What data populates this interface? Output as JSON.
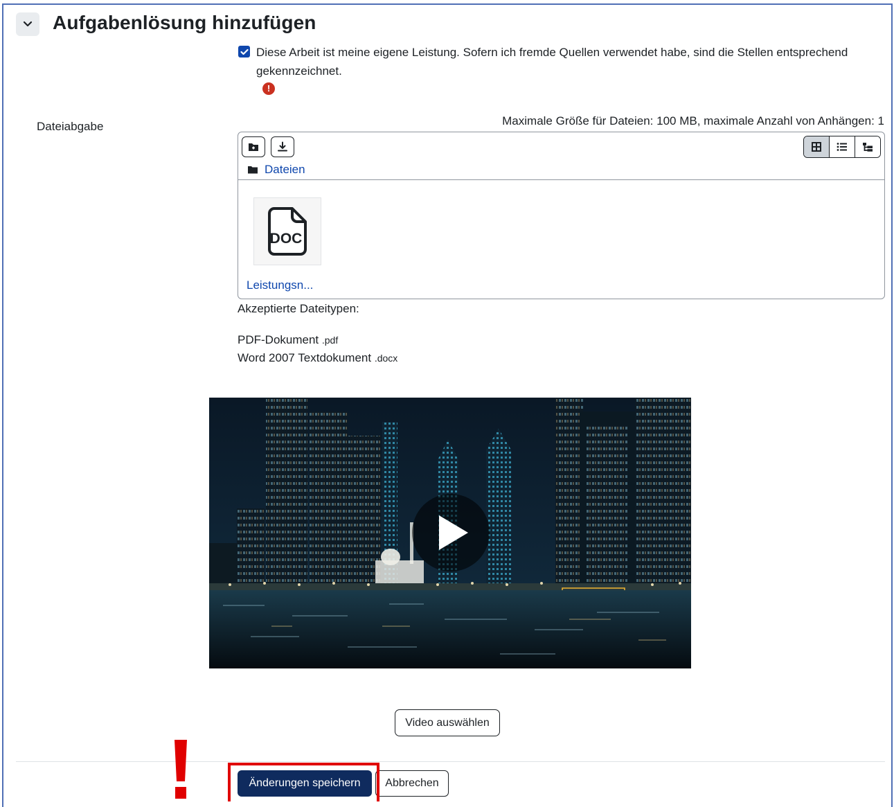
{
  "section": {
    "title": "Aufgabenlösung hinzufügen",
    "collapse_icon": "chevron-down-icon"
  },
  "own_work": {
    "checked": true,
    "label": "Diese Arbeit ist meine eigene Leistung. Sofern ich fremde Quellen verwendet habe, sind die Stellen entsprechend gekennzeichnet.",
    "error_icon": "!"
  },
  "file_submission": {
    "label": "Dateiabgabe",
    "limits": "Maximale Größe für Dateien: 100 MB, maximale Anzahl von Anhängen: 1",
    "toolbar": {
      "add_icon": "add-folder-icon",
      "download_icon": "download-icon",
      "view_modes": [
        "grid-view-icon",
        "list-view-icon",
        "tree-view-icon"
      ],
      "active_view": "grid-view-icon"
    },
    "path": "Dateien",
    "file": {
      "icon_text": "DOC",
      "name": "Leistungsn..."
    },
    "accepted_title": "Akzeptierte Dateitypen:",
    "accepted_types": [
      {
        "name": "PDF-Dokument",
        "ext": ".pdf"
      },
      {
        "name": "Word 2007 Textdokument",
        "ext": ".docx"
      }
    ]
  },
  "video": {
    "play_icon": "play-icon",
    "select_label": "Video auswählen"
  },
  "actions": {
    "save_label": "Änderungen speichern",
    "cancel_label": "Abbrechen"
  },
  "colors": {
    "primary": "#0f47ad",
    "save_button": "#0f2b5e",
    "error": "#ca3120",
    "annotation_red": "#e00000"
  }
}
